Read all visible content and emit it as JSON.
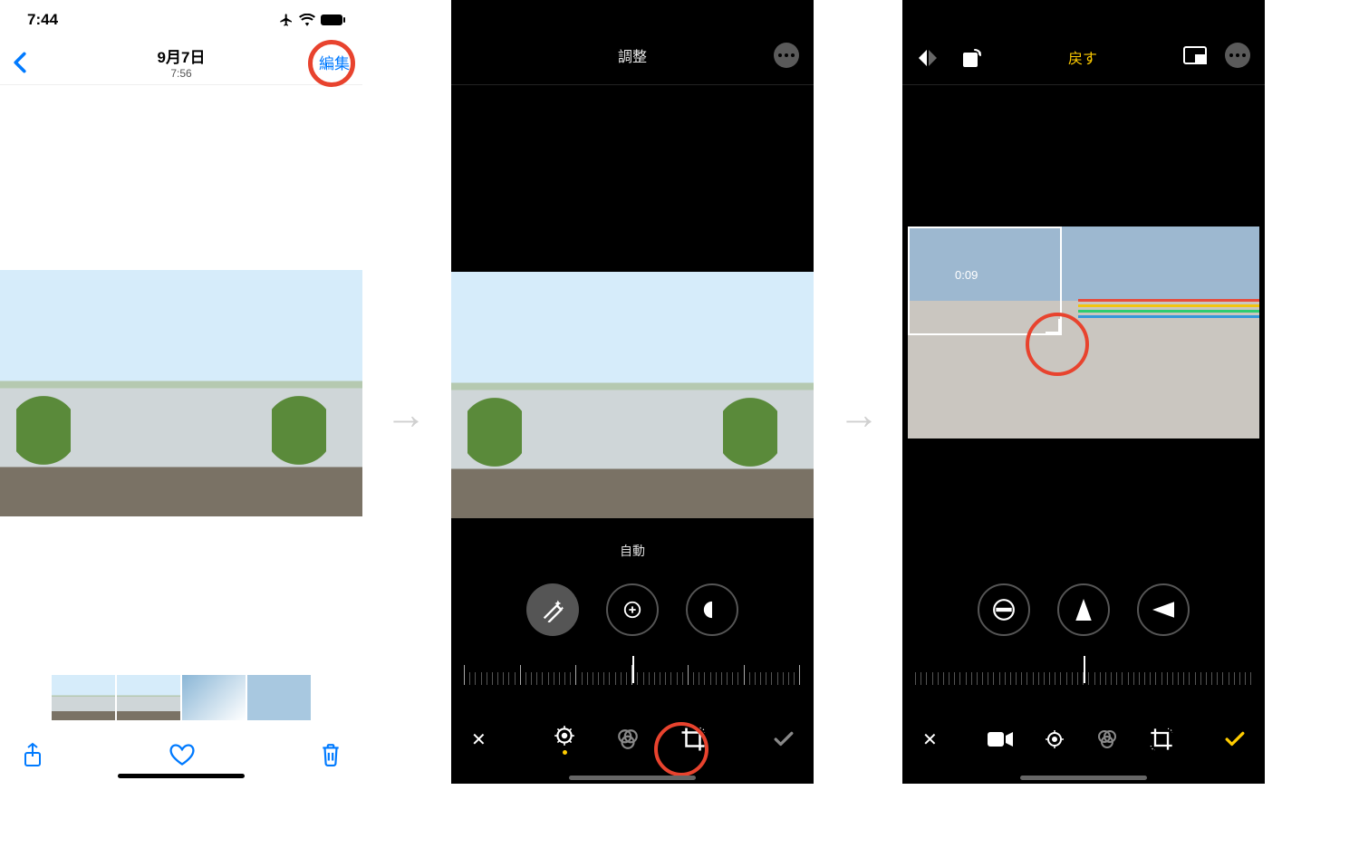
{
  "phone1": {
    "status_time": "7:44",
    "title_date": "9月7日",
    "title_time": "7:56",
    "edit_label": "編集"
  },
  "phone2": {
    "header_title": "調整",
    "auto_label": "自動"
  },
  "phone3": {
    "revert_label": "戻す",
    "crop_timecode": "0:09"
  },
  "colors": {
    "ios_blue": "#007aff",
    "ios_yellow": "#ffcc00",
    "highlight_red": "#e8432e"
  }
}
